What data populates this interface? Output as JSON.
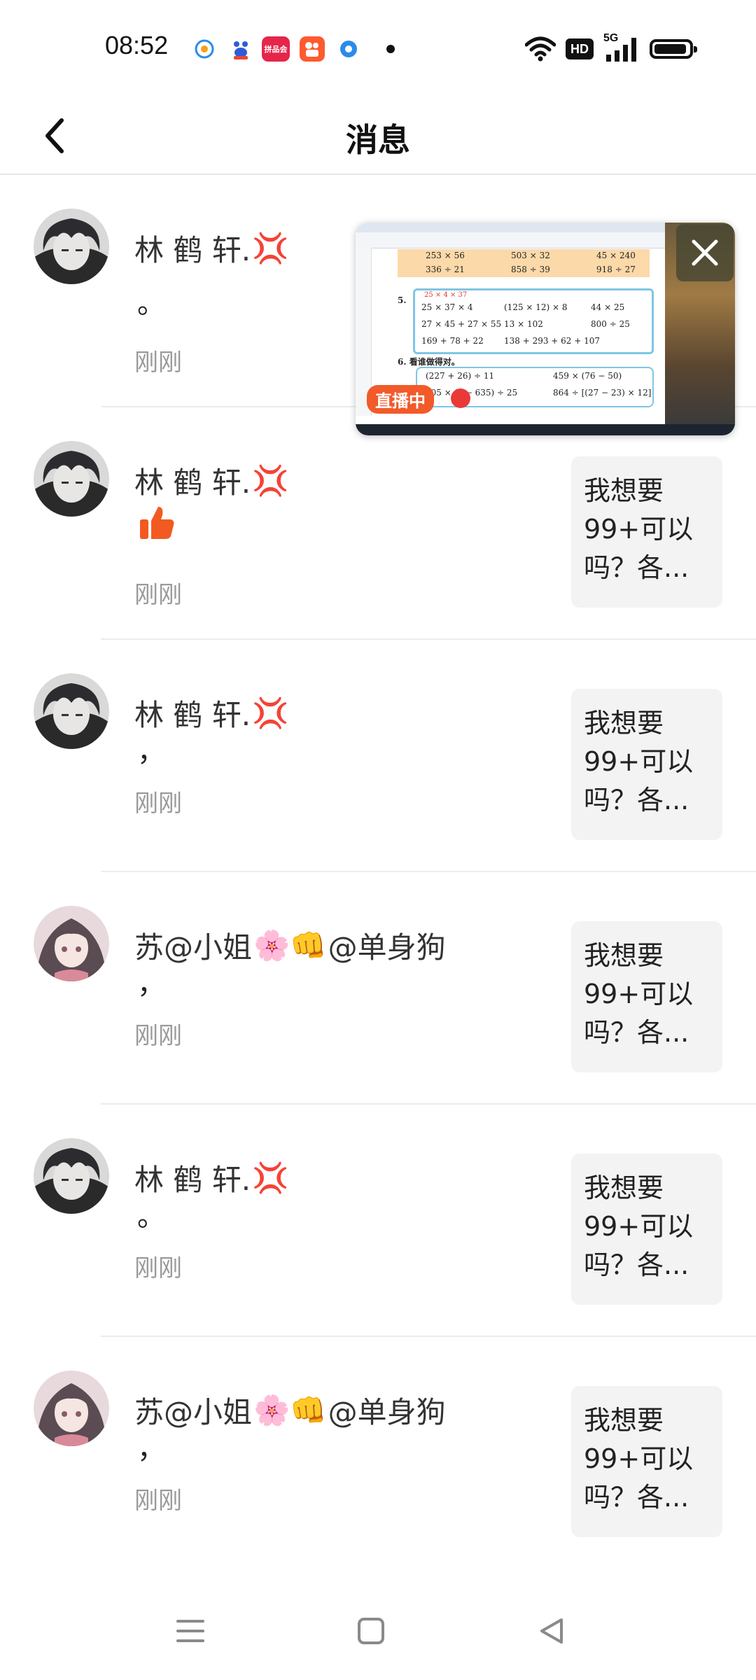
{
  "status_bar": {
    "time": "08:52",
    "app_icons": [
      "weibo-notify-icon",
      "baidu-icon",
      "pinduoduo-icon",
      "kuaishou-icon",
      "browser-icon"
    ],
    "pinduoduo_label": "拼品会",
    "hd_label": "HD",
    "network_label": "5G",
    "battery_level": 0.95
  },
  "header": {
    "title": "消息",
    "back_icon": "chevron-left-icon"
  },
  "live_window": {
    "badge": "直播中",
    "close_icon": "close-icon",
    "worksheet": {
      "row1": [
        "253 × 56",
        "503 × 32",
        "45 × 240"
      ],
      "row2": [
        "336 ÷ 21",
        "858 ÷ 39",
        "918 ÷ 27"
      ],
      "q5_label": "5.",
      "q5_note": "25 × 4 × 37",
      "q5_row1": [
        "25 × 37 × 4",
        "(125 × 12) × 8",
        "44 × 25"
      ],
      "q5_row2": [
        "27 × 45 + 27 × 55",
        "13 × 102",
        "800 ÷ 25"
      ],
      "q5_row3": [
        "169 + 78 + 22",
        "138 + 293 + 62 + 107"
      ],
      "q6_label": "6. 看谁做得对。",
      "q6_row1": [
        "(227 + 26) ÷ 11",
        "459 × (76 − 50)"
      ],
      "q6_row2": [
        "105 × (1 − 635) ÷ 25",
        "864 ÷ [(27 − 23) × 12]"
      ]
    }
  },
  "messages": [
    {
      "name": "林 鹤 轩.",
      "name_emoji": "💢",
      "content": "。",
      "time": "刚刚",
      "preview": "",
      "avatar": "dark-hair-boy"
    },
    {
      "name": "林 鹤 轩.",
      "name_emoji": "💢",
      "content": "👍",
      "time": "刚刚",
      "preview": "我想要99+可以吗？各...",
      "avatar": "dark-hair-boy"
    },
    {
      "name": "林 鹤 轩.",
      "name_emoji": "💢",
      "content": "，",
      "time": "刚刚",
      "preview": "我想要99+可以吗？各...",
      "avatar": "dark-hair-boy"
    },
    {
      "name": "苏@小姐",
      "name_emoji": "🌸👊",
      "name_suffix": "@单身狗",
      "content": "，",
      "time": "刚刚",
      "preview": "我想要99+可以吗？各...",
      "avatar": "anime-girl"
    },
    {
      "name": "林 鹤 轩.",
      "name_emoji": "💢",
      "content": "。",
      "time": "刚刚",
      "preview": "我想要99+可以吗？各...",
      "avatar": "dark-hair-boy"
    },
    {
      "name": "苏@小姐",
      "name_emoji": "🌸👊",
      "name_suffix": "@单身狗",
      "content": "，",
      "time": "刚刚",
      "preview": "我想要99+可以吗？各...",
      "avatar": "anime-girl"
    }
  ],
  "nav_bar": {
    "menu_icon": "menu-icon",
    "home_icon": "home-square-icon",
    "back_icon": "back-triangle-icon"
  },
  "colors": {
    "accent_live": "#f25a2a",
    "thumb_orange": "#f25a22",
    "preview_bg": "#f3f3f3",
    "time_gray": "#9a9a9a"
  }
}
